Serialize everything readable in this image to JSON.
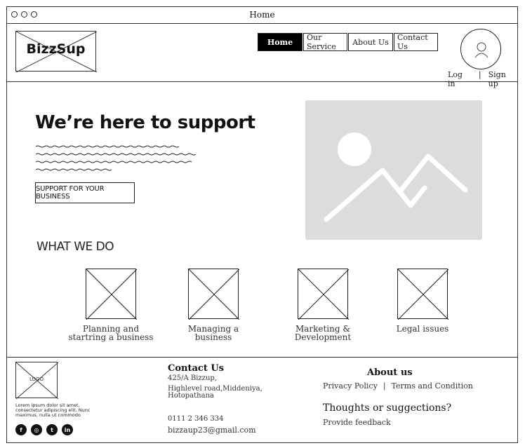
{
  "window": {
    "title": "Home"
  },
  "brand": {
    "name": "BizzSup"
  },
  "nav": {
    "items": [
      {
        "label": "Home",
        "active": true
      },
      {
        "label": "Our Service",
        "active": false
      },
      {
        "label": "About Us",
        "active": false
      },
      {
        "label": "Contact Us",
        "active": false
      }
    ]
  },
  "auth": {
    "login": "Log in",
    "separator": "|",
    "signup": "Sign up"
  },
  "hero": {
    "title": "We’re here to support",
    "cta_label": "SUPPORT FOR YOUR BUSINESS"
  },
  "services": {
    "title": "WHAT WE DO",
    "items": [
      {
        "label_line1": "Planning and",
        "label_line2": "startring a business"
      },
      {
        "label_line1": "Managing a business",
        "label_line2": ""
      },
      {
        "label_line1": "Marketing &",
        "label_line2": "Development"
      },
      {
        "label_line1": "Legal issues",
        "label_line2": ""
      }
    ]
  },
  "footer": {
    "logo_text": "LOGO",
    "lorem": "Lorem ipsum dolor sit amet, consectetur adipiscing elit. Nunc maximus, nulla ut commodo",
    "social": [
      "facebook-icon",
      "instagram-icon",
      "twitter-icon",
      "linkedin-icon"
    ],
    "contact": {
      "title": "Contact Us",
      "address1": "425/A Bizzup,",
      "address2": "Highlevel road,Middeniya,",
      "address3": "Hotopathana",
      "phone": "0111 2 346 334",
      "email": "bizzaup23@gmail.com"
    },
    "about": {
      "title": "About us",
      "privacy": "Privacy Policy",
      "separator": "|",
      "terms": "Terms and Condition",
      "thoughts": "Thoughts  or suggections?",
      "feedback": "Provide feedback"
    }
  },
  "colors": {
    "border": "#333333",
    "placeholder": "#dcdcdc",
    "active_nav": "#000000"
  }
}
